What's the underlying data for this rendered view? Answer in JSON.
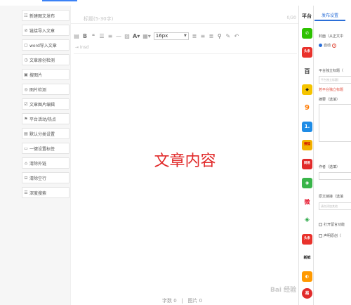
{
  "sidebar": {
    "items": [
      {
        "icon": "☷",
        "label": "新建图文发布"
      },
      {
        "icon": "⊘",
        "label": "链接导入文章"
      },
      {
        "icon": "▢",
        "label": "word导入文章"
      },
      {
        "icon": "◷",
        "label": "文章原创检测"
      },
      {
        "icon": "▣",
        "label": "搜图片"
      },
      {
        "icon": "◎",
        "label": "图片检测"
      },
      {
        "icon": "☑",
        "label": "文章图片编辑"
      },
      {
        "icon": "⚑",
        "label": "平台活动/热点"
      },
      {
        "icon": "▤",
        "label": "默认分类设置"
      },
      {
        "icon": "▭",
        "label": "一键设置标签"
      },
      {
        "icon": "⌂",
        "label": "清除外链"
      },
      {
        "icon": "⊟",
        "label": "清除空行"
      },
      {
        "icon": "☰",
        "label": "深度搜索"
      }
    ]
  },
  "editor": {
    "title_placeholder": "标题(5-30字)",
    "title_count": "0/30",
    "font_size": "16px",
    "toolbar_second_row": "⇥ Insd",
    "content": "文章内容",
    "stats": {
      "word_label": "字数",
      "word_count": "0",
      "separator": "|",
      "image_label": "图片",
      "image_count": "0"
    }
  },
  "platforms": {
    "header": "平台",
    "items": [
      {
        "name": "wechat",
        "text": "✆",
        "color": "#2dc100"
      },
      {
        "name": "toutiao",
        "text": "头条",
        "color": "#e9322c"
      },
      {
        "name": "baidu",
        "text": "百",
        "color": "#ffffff"
      },
      {
        "name": "qq",
        "text": "◆",
        "color": "#f5c400"
      },
      {
        "name": "uc",
        "text": "9",
        "color": "#ff7a00"
      },
      {
        "name": "yidian",
        "text": "1.",
        "color": "#1f8ce6"
      },
      {
        "name": "sohu",
        "text": "搜狐",
        "color": "#f2b100"
      },
      {
        "name": "wangyi",
        "text": "网易",
        "color": "#e12b2b"
      },
      {
        "name": "aiqiyi",
        "text": "◉",
        "color": "#39b54a"
      },
      {
        "name": "weibo",
        "text": "微",
        "color": "#ffffff"
      },
      {
        "name": "kuaibao",
        "text": "◈",
        "color": "#28a745"
      },
      {
        "name": "toutiao2",
        "text": "头条",
        "color": "#e9322c"
      },
      {
        "name": "zaker",
        "text": "新鲜",
        "color": "#ffffff"
      },
      {
        "name": "orange",
        "text": "◐",
        "color": "#ff9900"
      },
      {
        "name": "wangyi2",
        "text": "易",
        "color": "#e12b2b"
      }
    ]
  },
  "settings": {
    "tab": "发布设置",
    "cover_label": "封面（从正文中",
    "cover_option": "自动",
    "platform_title_label": "平台独立标题（",
    "platform_title_placeholder": "平台独立标题(",
    "platform_title_warning": "若平台独立标题",
    "summary_label": "摘要（选填）",
    "author_label": "作者（选填）",
    "source_link_label": "原文链接（选填",
    "source_link_placeholder": "请勿添加其他",
    "open_comments_label": "打开留言功能",
    "declare_original_label": "声明原创（"
  },
  "watermark": "Bai 经验"
}
